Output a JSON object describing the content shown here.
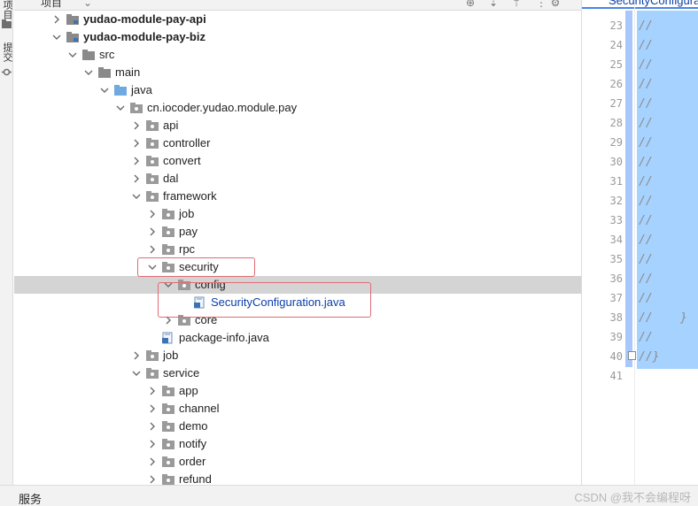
{
  "left_stripe": {
    "top_label": "项目",
    "middle_label": "提交"
  },
  "project_panel": {
    "title": "项目"
  },
  "tree": [
    {
      "label": "yudao-module-pay-api",
      "depth": 0,
      "expanded": false,
      "icon": "module-folder-icon",
      "bold": true
    },
    {
      "label": "yudao-module-pay-biz",
      "depth": 0,
      "expanded": true,
      "icon": "module-folder-icon",
      "bold": true
    },
    {
      "label": "src",
      "depth": 1,
      "expanded": true,
      "icon": "folder-icon"
    },
    {
      "label": "main",
      "depth": 2,
      "expanded": true,
      "icon": "folder-icon"
    },
    {
      "label": "java",
      "depth": 3,
      "expanded": true,
      "icon": "source-folder-icon"
    },
    {
      "label": "cn.iocoder.yudao.module.pay",
      "depth": 4,
      "expanded": true,
      "icon": "package-icon"
    },
    {
      "label": "api",
      "depth": 5,
      "expanded": false,
      "icon": "package-icon"
    },
    {
      "label": "controller",
      "depth": 5,
      "expanded": false,
      "icon": "package-icon"
    },
    {
      "label": "convert",
      "depth": 5,
      "expanded": false,
      "icon": "package-icon"
    },
    {
      "label": "dal",
      "depth": 5,
      "expanded": false,
      "icon": "package-icon"
    },
    {
      "label": "framework",
      "depth": 5,
      "expanded": true,
      "icon": "package-icon"
    },
    {
      "label": "job",
      "depth": 6,
      "expanded": false,
      "icon": "package-icon"
    },
    {
      "label": "pay",
      "depth": 6,
      "expanded": false,
      "icon": "package-icon"
    },
    {
      "label": "rpc",
      "depth": 6,
      "expanded": false,
      "icon": "package-icon"
    },
    {
      "label": "security",
      "depth": 6,
      "expanded": true,
      "icon": "package-icon"
    },
    {
      "label": "config",
      "depth": 7,
      "expanded": true,
      "icon": "package-icon",
      "selected": true
    },
    {
      "label": "SecurityConfiguration.java",
      "depth": 8,
      "leaf": true,
      "icon": "java-file-icon",
      "blue": true
    },
    {
      "label": "core",
      "depth": 7,
      "expanded": false,
      "icon": "package-icon"
    },
    {
      "label": "package-info.java",
      "depth": 6,
      "leaf": true,
      "icon": "java-file-icon"
    },
    {
      "label": "job",
      "depth": 5,
      "expanded": false,
      "icon": "package-icon"
    },
    {
      "label": "service",
      "depth": 5,
      "expanded": true,
      "icon": "package-icon"
    },
    {
      "label": "app",
      "depth": 6,
      "expanded": false,
      "icon": "package-icon"
    },
    {
      "label": "channel",
      "depth": 6,
      "expanded": false,
      "icon": "package-icon"
    },
    {
      "label": "demo",
      "depth": 6,
      "expanded": false,
      "icon": "package-icon"
    },
    {
      "label": "notify",
      "depth": 6,
      "expanded": false,
      "icon": "package-icon"
    },
    {
      "label": "order",
      "depth": 6,
      "expanded": false,
      "icon": "package-icon"
    },
    {
      "label": "refund",
      "depth": 6,
      "expanded": false,
      "icon": "package-icon"
    }
  ],
  "editor": {
    "tab_title": "SecurityConfigura",
    "lines": [
      {
        "no": "23",
        "text": "//"
      },
      {
        "no": "24",
        "text": "//"
      },
      {
        "no": "25",
        "text": "//"
      },
      {
        "no": "26",
        "text": "//"
      },
      {
        "no": "27",
        "text": "//"
      },
      {
        "no": "28",
        "text": "//"
      },
      {
        "no": "29",
        "text": "//"
      },
      {
        "no": "30",
        "text": "//"
      },
      {
        "no": "31",
        "text": "//"
      },
      {
        "no": "32",
        "text": "//"
      },
      {
        "no": "33",
        "text": "//"
      },
      {
        "no": "34",
        "text": "//"
      },
      {
        "no": "35",
        "text": "//"
      },
      {
        "no": "36",
        "text": "//"
      },
      {
        "no": "37",
        "text": "//"
      },
      {
        "no": "38",
        "text": "//    }"
      },
      {
        "no": "39",
        "text": "//"
      },
      {
        "no": "40",
        "text": "//}"
      },
      {
        "no": "41",
        "text": ""
      }
    ]
  },
  "bottom_bar": {
    "left_label": "服务",
    "watermark": "CSDN @我不会编程呀"
  }
}
